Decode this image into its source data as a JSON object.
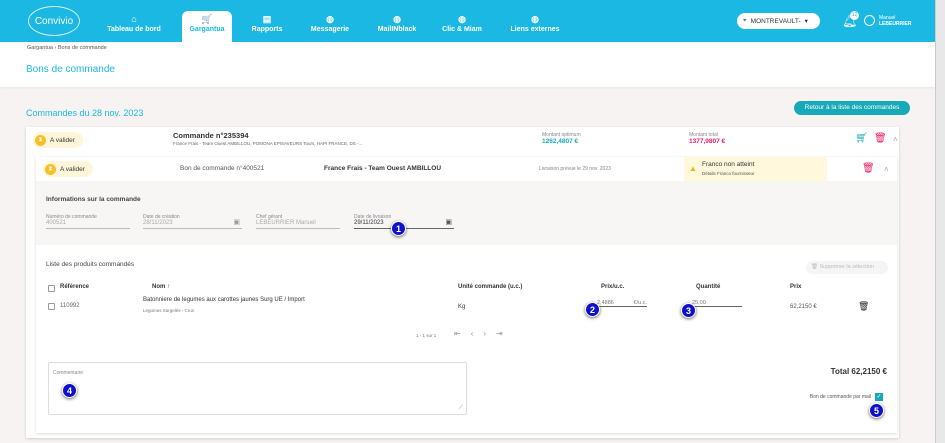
{
  "header": {
    "logo": "Convivio",
    "nav": [
      {
        "label": "Tableau de bord",
        "icon": "home-icon"
      },
      {
        "label": "Gargantua",
        "icon": "cart-icon"
      },
      {
        "label": "Rapports",
        "icon": "clipboard-icon"
      },
      {
        "label": "Messagerie",
        "icon": "globe-icon"
      },
      {
        "label": "MailINblack",
        "icon": "globe-icon"
      },
      {
        "label": "Clic & Miam",
        "icon": "globe-icon"
      },
      {
        "label": "Liens externes",
        "icon": "globe-icon"
      }
    ],
    "location": "MONTREVAULT-",
    "notifications": "12",
    "user_first": "Manuel",
    "user_last": "LEBEURRIER"
  },
  "breadcrumb": "Gargantua › Bons de commande",
  "page_title": "Bons de commande",
  "section_title": "Commandes du 28 nov. 2023",
  "back_button": "Retour à la liste des commandes",
  "order": {
    "status": "A valider",
    "title": "Commande n°235394",
    "suppliers": "France Frais - Team Ouest AMBILLOU, POMONA EPISAVEURS Tours, HAPI FRANCE, DS -...",
    "optimum_label": "Montant optimum",
    "optimum_value": "1262,4807 €",
    "total_label": "Montant total",
    "total_value": "1377,9807 €"
  },
  "po": {
    "status": "A valider",
    "title": "Bon de commande n°400521",
    "supplier": "France Frais - Team Ouest AMBILLOU",
    "delivery": "Livraison prévue le 29 nov. 2023",
    "franco_title": "Franco non atteint",
    "franco_detail": "Détails Franco fournisseur",
    "info_title": "Informations sur la commande",
    "fields": [
      {
        "label": "Numéro de commande",
        "value": "400521"
      },
      {
        "label": "Date de création",
        "value": "28/11/2023"
      },
      {
        "label": "Chef gérant",
        "value": "LEBEURRIER Manuel"
      },
      {
        "label": "Date de livraison",
        "value": "29/11/2023"
      }
    ],
    "products_title": "Liste des produits commandés",
    "delete_selection": "Supprimer la sélection",
    "columns": [
      "Référence",
      "Nom",
      "Unité commande (u.c.)",
      "Prix/u.c.",
      "Quantité",
      "Prix"
    ],
    "rows": [
      {
        "ref": "110992",
        "name": "Batonniere de legumes aux carottes jaunes Surg UE / Import",
        "category": "Legumes Surgelés - Crus",
        "unit": "Kg",
        "price_uc": "2,4886",
        "price_unit": "€/u.c.",
        "qty": "25,00",
        "price": "62,2150 €"
      }
    ],
    "pagination": "1 - 1 sur 1",
    "comment_label": "Commentaire",
    "total": "Total 62,2150 €",
    "mail_label": "Bon de commande par mail"
  },
  "annotations": [
    "1",
    "2",
    "3",
    "4",
    "5"
  ]
}
